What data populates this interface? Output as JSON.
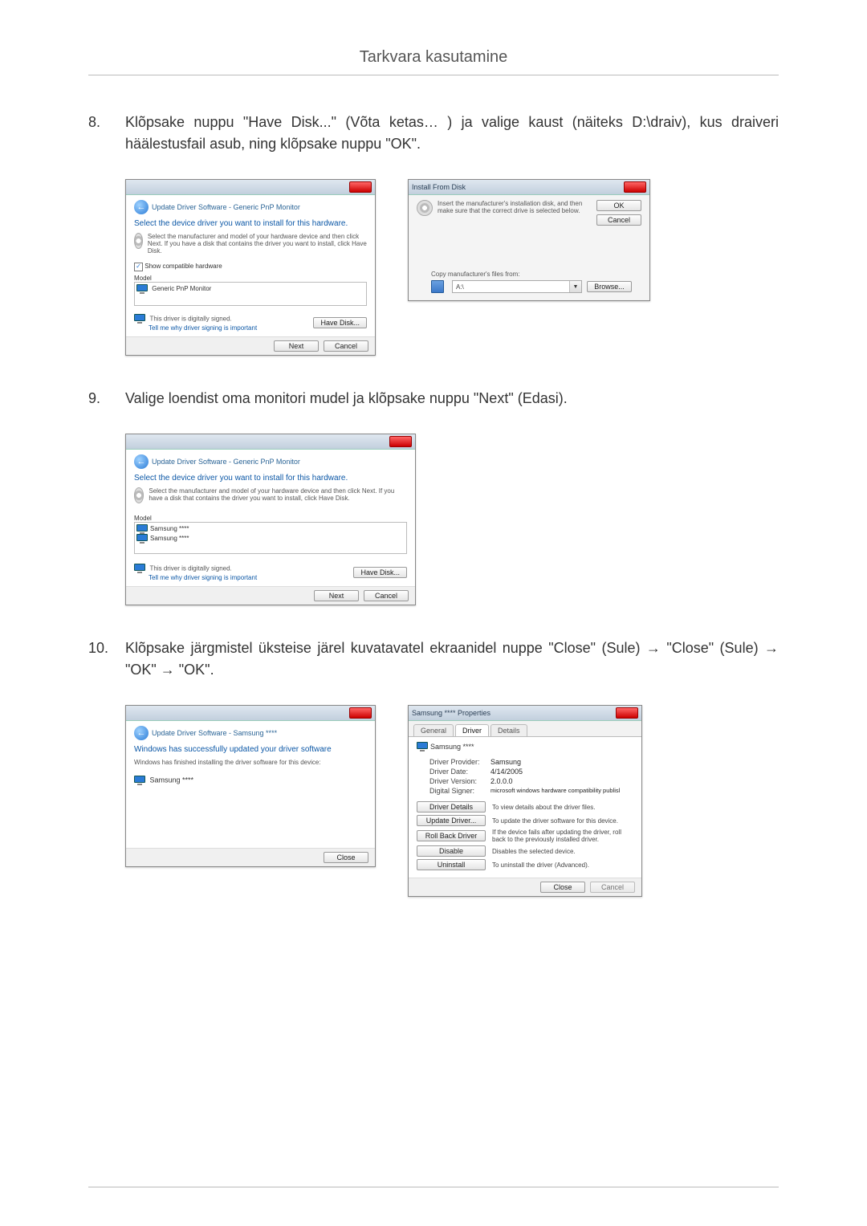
{
  "page": {
    "title": "Tarkvara kasutamine"
  },
  "steps": {
    "s8": {
      "num": "8.",
      "text": "Klõpsake nuppu \"Have Disk...\" (Võta ketas… ) ja valige kaust (näiteks D:\\draiv), kus draiveri häälestusfail asub, ning klõpsake nuppu \"OK\"."
    },
    "s9": {
      "num": "9.",
      "text": "Valige loendist oma monitori mudel ja klõpsake nuppu \"Next\" (Edasi)."
    },
    "s10": {
      "num": "10.",
      "text": "Klõpsake järgmistel üksteise järel kuvatavatel ekraanidel nuppe \"Close\" (Sule) → \"Close\" (Sule) → \"OK\" → \"OK\"."
    }
  },
  "dlgA": {
    "title": "Update Driver Software - Generic PnP Monitor",
    "heading": "Select the device driver you want to install for this hardware.",
    "desc": "Select the manufacturer and model of your hardware device and then click Next. If you have a disk that contains the driver you want to install, click Have Disk.",
    "compat_label": "Show compatible hardware",
    "model_label": "Model",
    "model_item": "Generic PnP Monitor",
    "signed": "This driver is digitally signed.",
    "signed_link": "Tell me why driver signing is important",
    "have_disk": "Have Disk...",
    "next": "Next",
    "cancel": "Cancel"
  },
  "dlgB": {
    "title": "Install From Disk",
    "msg": "Insert the manufacturer's installation disk, and then make sure that the correct drive is selected below.",
    "ok": "OK",
    "cancel": "Cancel",
    "copy_label": "Copy manufacturer's files from:",
    "combo_value": "A:\\",
    "browse": "Browse..."
  },
  "dlgC": {
    "title": "Update Driver Software - Generic PnP Monitor",
    "heading": "Select the device driver you want to install for this hardware.",
    "desc": "Select the manufacturer and model of your hardware device and then click Next. If you have a disk that contains the driver you want to install, click Have Disk.",
    "model_label": "Model",
    "model_item1": "Samsung ****",
    "model_item2": "Samsung ****",
    "signed": "This driver is digitally signed.",
    "signed_link": "Tell me why driver signing is important",
    "have_disk": "Have Disk...",
    "next": "Next",
    "cancel": "Cancel"
  },
  "dlgD": {
    "title": "Update Driver Software - Samsung ****",
    "heading": "Windows has successfully updated your driver software",
    "desc": "Windows has finished installing the driver software for this device:",
    "device": "Samsung ****",
    "close": "Close"
  },
  "dlgE": {
    "title": "Samsung **** Properties",
    "tabs": {
      "general": "General",
      "driver": "Driver",
      "details": "Details"
    },
    "device": "Samsung ****",
    "rows": {
      "provider_l": "Driver Provider:",
      "provider_v": "Samsung",
      "date_l": "Driver Date:",
      "date_v": "4/14/2005",
      "version_l": "Driver Version:",
      "version_v": "2.0.0.0",
      "signer_l": "Digital Signer:",
      "signer_v": "microsoft windows hardware compatibility publisl"
    },
    "actions": {
      "details_btn": "Driver Details",
      "details_desc": "To view details about the driver files.",
      "update_btn": "Update Driver...",
      "update_desc": "To update the driver software for this device.",
      "rollback_btn": "Roll Back Driver",
      "rollback_desc": "If the device fails after updating the driver, roll back to the previously installed driver.",
      "disable_btn": "Disable",
      "disable_desc": "Disables the selected device.",
      "uninstall_btn": "Uninstall",
      "uninstall_desc": "To uninstall the driver (Advanced)."
    },
    "close": "Close",
    "cancel": "Cancel"
  }
}
